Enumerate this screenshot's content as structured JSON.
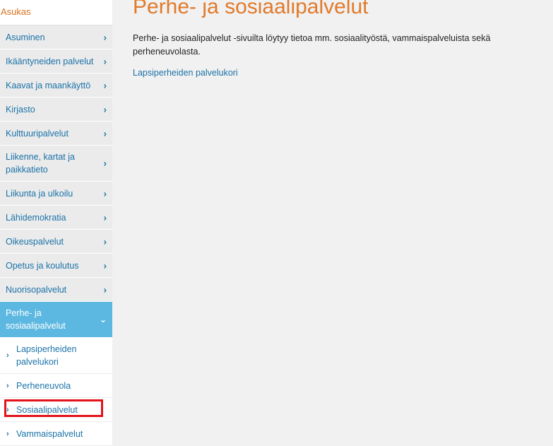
{
  "sidebar": {
    "header": "Asukas",
    "items": [
      {
        "label": "Asuminen"
      },
      {
        "label": "Ikääntyneiden palvelut"
      },
      {
        "label": "Kaavat ja maankäyttö"
      },
      {
        "label": "Kirjasto"
      },
      {
        "label": "Kulttuuripalvelut"
      },
      {
        "label": "Liikenne, kartat ja paikkatieto"
      },
      {
        "label": "Liikunta ja ulkoilu"
      },
      {
        "label": "Lähidemokratia"
      },
      {
        "label": "Oikeuspalvelut"
      },
      {
        "label": "Opetus ja koulutus"
      },
      {
        "label": "Nuorisopalvelut"
      },
      {
        "label": "Perhe- ja sosiaalipalvelut"
      }
    ],
    "subitems": [
      {
        "label": "Lapsiperheiden palvelukori"
      },
      {
        "label": "Perheneuvola"
      },
      {
        "label": "Sosiaalipalvelut"
      },
      {
        "label": "Vammaispalvelut"
      }
    ]
  },
  "main": {
    "title": "Perhe- ja sosiaalipalvelut",
    "intro": "Perhe- ja sosiaalipalvelut -sivuilta löytyy tietoa mm.  sosiaalityöstä, vammaispalveluista sekä perheneuvolasta.",
    "link": "Lapsiperheiden palvelukori"
  },
  "icons": {
    "chevron_right": "›",
    "chevron_down": "⌄"
  },
  "colors": {
    "title": "#e07a2b",
    "link": "#1b72a8",
    "active_bg": "#5cb8e0",
    "highlight": "#e3121b"
  }
}
